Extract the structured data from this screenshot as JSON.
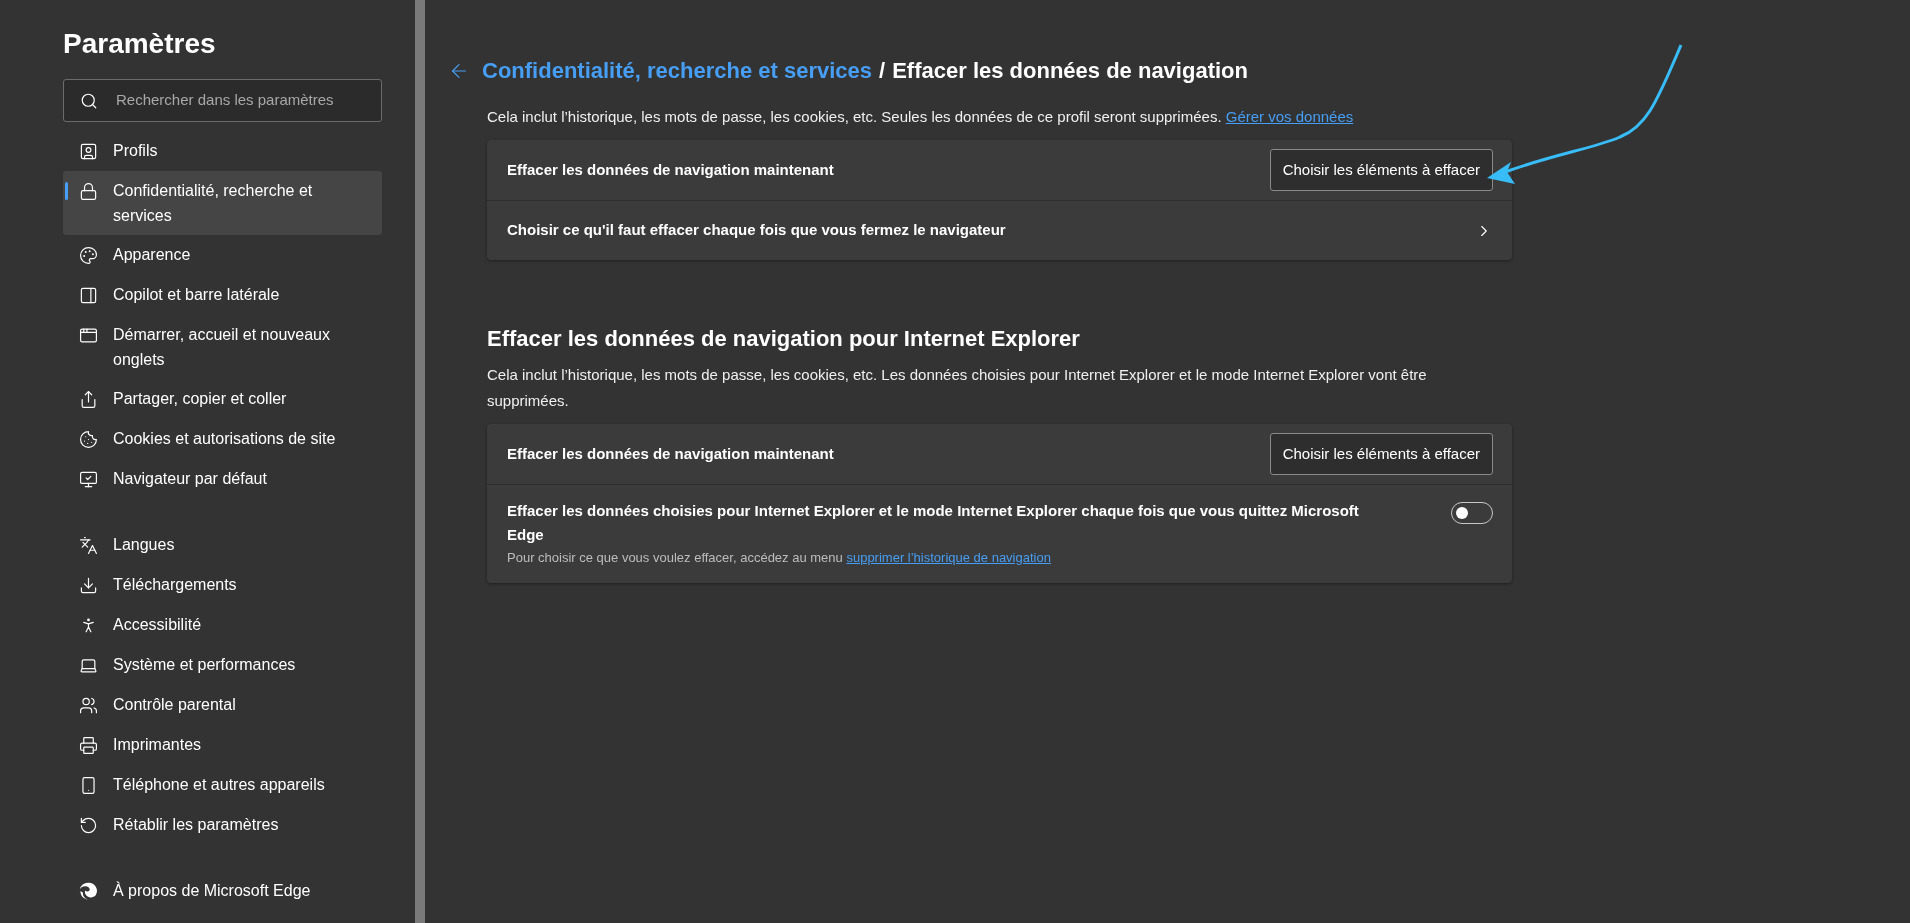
{
  "sidebar": {
    "title": "Paramètres",
    "search": {
      "placeholder": "Rechercher dans les paramètres"
    },
    "groups": [
      {
        "items": [
          {
            "label": "Profils",
            "selected": false
          },
          {
            "label": "Confidentialité, recherche et services",
            "selected": true
          },
          {
            "label": "Apparence",
            "selected": false
          },
          {
            "label": "Copilot et barre latérale",
            "selected": false
          },
          {
            "label": "Démarrer, accueil et nouveaux onglets",
            "selected": false
          },
          {
            "label": "Partager, copier et coller",
            "selected": false
          },
          {
            "label": "Cookies et autorisations de site",
            "selected": false
          },
          {
            "label": "Navigateur par défaut",
            "selected": false
          }
        ]
      },
      {
        "items": [
          {
            "label": "Langues",
            "selected": false
          },
          {
            "label": "Téléchargements",
            "selected": false
          },
          {
            "label": "Accessibilité",
            "selected": false
          },
          {
            "label": "Système et performances",
            "selected": false
          },
          {
            "label": "Contrôle parental",
            "selected": false
          },
          {
            "label": "Imprimantes",
            "selected": false
          },
          {
            "label": "Téléphone et autres appareils",
            "selected": false
          },
          {
            "label": "Rétablir les paramètres",
            "selected": false
          }
        ]
      },
      {
        "items": [
          {
            "label": "À propos de Microsoft Edge",
            "selected": false
          }
        ]
      }
    ]
  },
  "breadcrumb": {
    "parent": "Confidentialité, recherche et services",
    "separator": "/",
    "current": "Effacer les données de navigation"
  },
  "sections": [
    {
      "description": "Cela inclut l’historique, les mots de passe, les cookies, etc. Seules les données de ce profil seront supprimées.",
      "link": "Gérer vos données",
      "rows": [
        {
          "kind": "button",
          "label": "Effacer les données de navigation maintenant",
          "button": "Choisir les éléments à effacer"
        },
        {
          "kind": "chevron",
          "label": "Choisir ce qu'il faut effacer chaque fois que vous fermez le navigateur"
        }
      ]
    },
    {
      "heading": "Effacer les données de navigation pour Internet Explorer",
      "description": "Cela inclut l’historique, les mots de passe, les cookies, etc. Les données choisies pour Internet Explorer et le mode Internet Explorer vont être supprimées.",
      "rows": [
        {
          "kind": "button",
          "label": "Effacer les données de navigation maintenant",
          "button": "Choisir les éléments à effacer"
        },
        {
          "kind": "toggle",
          "label": "Effacer les données choisies pour Internet Explorer et le mode Internet Explorer chaque fois que vous quittez Microsoft Edge",
          "hint": "Pour choisir ce que vous voulez effacer, accédez au menu",
          "hint_link": "supprimer l’historique de navigation",
          "on": false
        }
      ]
    }
  ]
}
